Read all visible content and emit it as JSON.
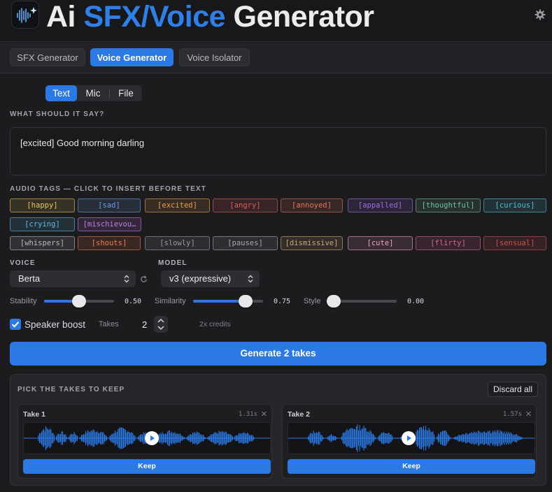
{
  "header": {
    "title_ai": "Ai",
    "title_sfx_voice": "SFX/Voice",
    "title_generator": "Generator"
  },
  "tabs": [
    "SFX Generator",
    "Voice Generator",
    "Voice Isolator"
  ],
  "active_tab": "Voice Generator",
  "input_modes": [
    "Text",
    "Mic",
    "File"
  ],
  "active_input_mode": "Text",
  "prompt": {
    "label": "WHAT SHOULD IT SAY?",
    "value": "[excited] Good morning darling"
  },
  "audio_tags": {
    "label": "AUDIO TAGS — CLICK TO INSERT BEFORE TEXT",
    "items": [
      {
        "text": "[happy]",
        "color": "#e8c35a"
      },
      {
        "text": "[sad]",
        "color": "#6f9be6"
      },
      {
        "text": "[excited]",
        "color": "#f0a04b"
      },
      {
        "text": "[angry]",
        "color": "#e05c5c"
      },
      {
        "text": "[annoyed]",
        "color": "#e8745a"
      },
      {
        "text": "[appalled]",
        "color": "#a06ae8"
      },
      {
        "text": "[thoughtful]",
        "color": "#6fc0a0"
      },
      {
        "text": "[curious]",
        "color": "#49c4d4"
      },
      {
        "text": "[crying]",
        "color": "#5ab8e8"
      },
      {
        "text": "[mischievou…",
        "color": "#c47ae8"
      },
      {
        "text": "[whispers]",
        "color": "#b9b9bf"
      },
      {
        "text": "[shouts]",
        "color": "#f07a4b"
      },
      {
        "text": "[slowly]",
        "color": "#9a9aa1"
      },
      {
        "text": "[pauses]",
        "color": "#a8a8ae"
      },
      {
        "text": "[dismissive]",
        "color": "#c9a878"
      },
      {
        "text": "[cute]",
        "color": "#f0a0c0"
      },
      {
        "text": "[flirty]",
        "color": "#e0609a"
      },
      {
        "text": "[sensual]",
        "color": "#d05050"
      }
    ]
  },
  "voice": {
    "label": "VOICE",
    "value": "Berta"
  },
  "model": {
    "label": "MODEL",
    "value": "v3 (expressive)"
  },
  "sliders": [
    {
      "label": "Stability",
      "value": 0.5,
      "display": "0.50"
    },
    {
      "label": "Similarity",
      "value": 0.75,
      "display": "0.75"
    },
    {
      "label": "Style",
      "value": 0.0,
      "display": "0.00"
    }
  ],
  "speaker_boost": {
    "label": "Speaker boost",
    "checked": true
  },
  "takes": {
    "label": "Takes",
    "value": "2",
    "credits": "2x credits"
  },
  "generate_button": "Generate 2 takes",
  "results": {
    "label": "PICK THE TAKES TO KEEP",
    "discard_all": "Discard all",
    "takes": [
      {
        "name": "Take 1",
        "duration": "1.31s",
        "keep": "Keep",
        "playhead": 0.52
      },
      {
        "name": "Take 2",
        "duration": "1.57s",
        "keep": "Keep",
        "playhead": 0.49
      }
    ]
  },
  "colors": {
    "accent": "#2b79e4",
    "background": "#1c1c1f"
  }
}
